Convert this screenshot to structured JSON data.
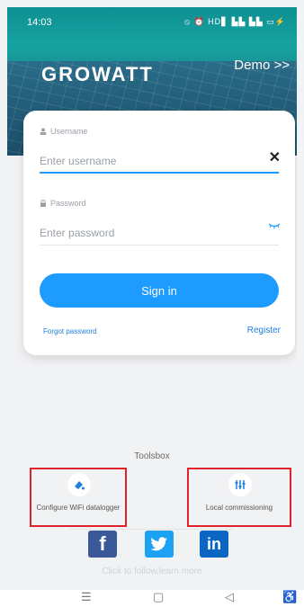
{
  "status_bar": {
    "time": "14:03",
    "icons": "⦸ ⏰ HD▋ ▙▙ ▙▙ ▭⚡"
  },
  "brand": {
    "logo_text": "GROWATT",
    "demo_link": "Demo >>"
  },
  "login": {
    "username_label": "Username",
    "username_placeholder": "Enter username",
    "username_value": "",
    "password_label": "Password",
    "password_placeholder": "Enter password",
    "password_value": "",
    "sign_in": "Sign in",
    "forgot_password": "Forgot password",
    "register": "Register"
  },
  "toolsbox": {
    "title": "Toolsbox",
    "items": [
      {
        "label": "Configure WiFi datalogger",
        "icon": "wifi-datalogger-icon"
      },
      {
        "label": "Local commissioning",
        "icon": "sliders-icon"
      }
    ]
  },
  "social": {
    "facebook": "f",
    "twitter": "twitter-bird-icon",
    "linkedin": "in",
    "follow_text": "Click to follow,learn more"
  },
  "colors": {
    "accent": "#1e9bff",
    "highlight_box": "#e0222a"
  }
}
